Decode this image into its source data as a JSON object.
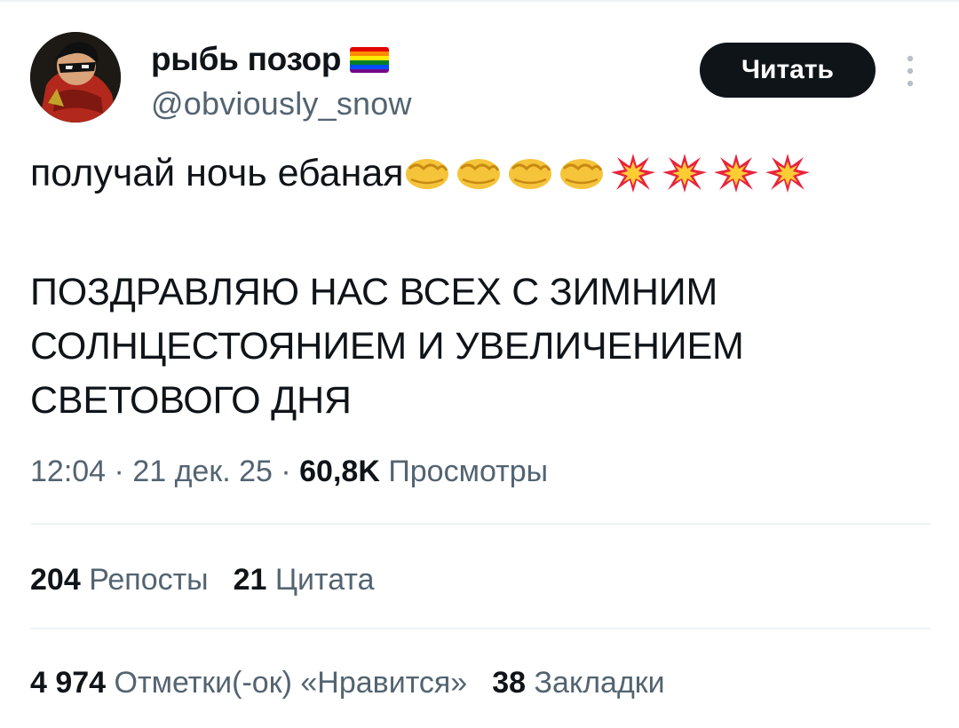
{
  "author": {
    "display_name": "рыбь позор",
    "handle": "@obviously_snow",
    "flag_icon": "rainbow-flag-icon"
  },
  "follow_button": {
    "label": "Читать"
  },
  "more_icon": "more-vertical-icon",
  "tweet": {
    "line1": "получай ночь ебаная",
    "emojis": [
      "fist-emoji-icon",
      "fist-emoji-icon",
      "fist-emoji-icon",
      "fist-emoji-icon",
      "collision-emoji-icon",
      "collision-emoji-icon",
      "collision-emoji-icon",
      "collision-emoji-icon"
    ],
    "line2": "ПОЗДРАВЛЯЮ НАС ВСЕХ С ЗИМНИМ\nСОЛНЦЕСТОЯНИЕМ И УВЕЛИЧЕНИЕМ\nСВЕТОВОГО ДНЯ"
  },
  "meta": {
    "time": "12:04",
    "separator": " · ",
    "date": "21 дек. 25",
    "views_count": "60,8K",
    "views_label": "Просмотры"
  },
  "stats": {
    "reposts_count": "204",
    "reposts_label": "Репосты",
    "quotes_count": "21",
    "quotes_label": "Цитата",
    "likes_count": "4 974",
    "likes_label": "Отметки(-ок) «Нравится»",
    "bookmarks_count": "38",
    "bookmarks_label": "Закладки"
  },
  "colors": {
    "text": "#0f1419",
    "secondary": "#536471",
    "divider": "#eff3f4",
    "button_bg": "#0f1419"
  }
}
